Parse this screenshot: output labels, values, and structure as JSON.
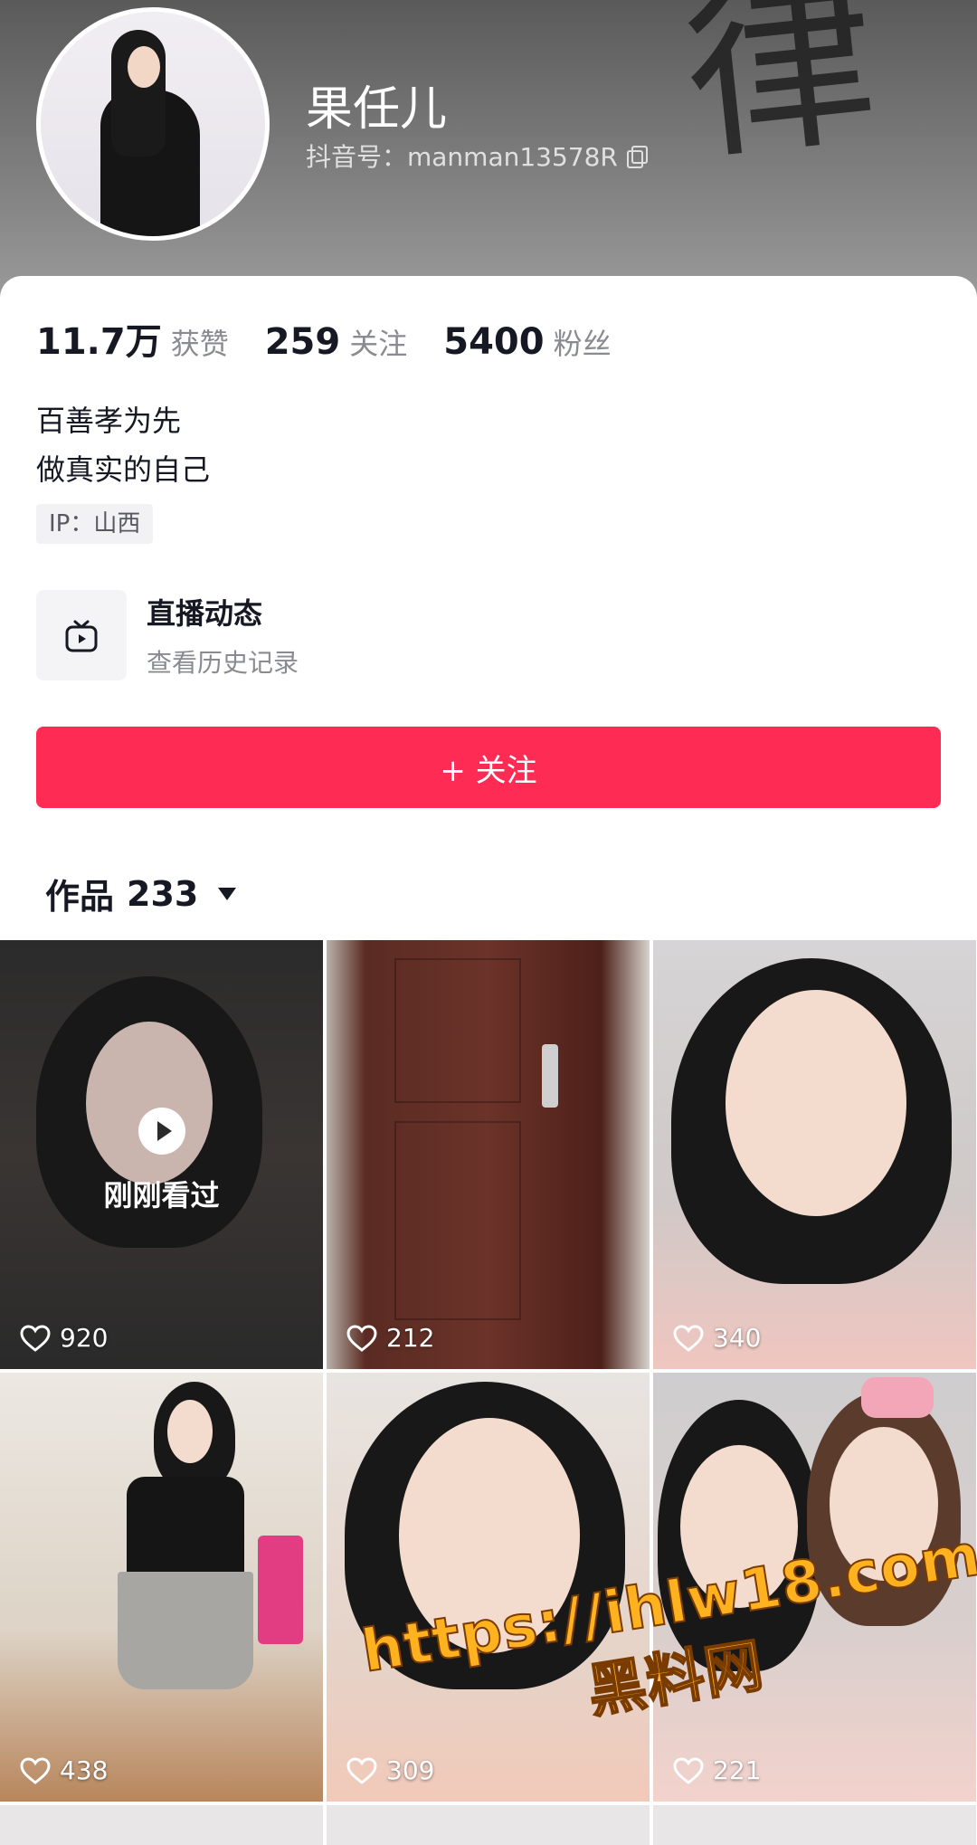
{
  "profile": {
    "name": "果任儿",
    "douyin_id_label": "抖音号：manman13578R",
    "stats": [
      {
        "num": "11.7万",
        "label": "获赞"
      },
      {
        "num": "259",
        "label": "关注"
      },
      {
        "num": "5400",
        "label": "粉丝"
      }
    ],
    "bio": [
      "百善孝为先",
      "做真实的自己"
    ],
    "ip": "IP：山西"
  },
  "live": {
    "title": "直播动态",
    "subtitle": "查看历史记录",
    "icon": "tv-play-icon"
  },
  "follow_button": {
    "label": "+ 关注",
    "color": "#fe2c55"
  },
  "works_tab": {
    "label": "作品",
    "count": "233"
  },
  "videos": [
    {
      "likes": "920",
      "overlay": "刚刚看过"
    },
    {
      "likes": "212"
    },
    {
      "likes": "340"
    },
    {
      "likes": "438"
    },
    {
      "likes": "309"
    },
    {
      "likes": "221"
    }
  ],
  "watermark": {
    "url": "https://ihlw18.com",
    "name": "黑料网"
  }
}
